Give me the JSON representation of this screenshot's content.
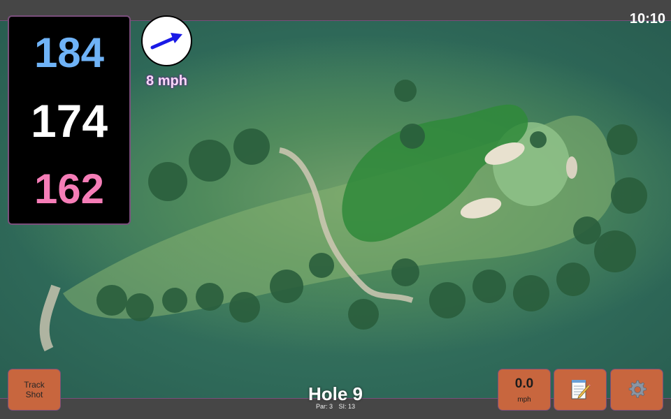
{
  "status": {
    "time": "10:10"
  },
  "distances": {
    "back": "184",
    "center": "174",
    "front": "162"
  },
  "wind": {
    "speed": "8 mph",
    "icon": "wind-direction-arrow-icon",
    "arrow_color": "#1a1ae6"
  },
  "hole": {
    "title": "Hole 9",
    "par": "Par: 3",
    "stroke_index": "SI: 13"
  },
  "buttons": {
    "track_shot_line1": "Track",
    "track_shot_line2": "Shot",
    "speed_value": "0.0",
    "speed_unit": "mph",
    "notes_icon": "notepad-icon",
    "settings_icon": "gear-icon"
  },
  "colors": {
    "back_distance": "#6fb3f7",
    "center_distance": "#ffffff",
    "front_distance": "#f57db7",
    "button": "#c8663e",
    "accent_border": "#7a4f7c"
  }
}
